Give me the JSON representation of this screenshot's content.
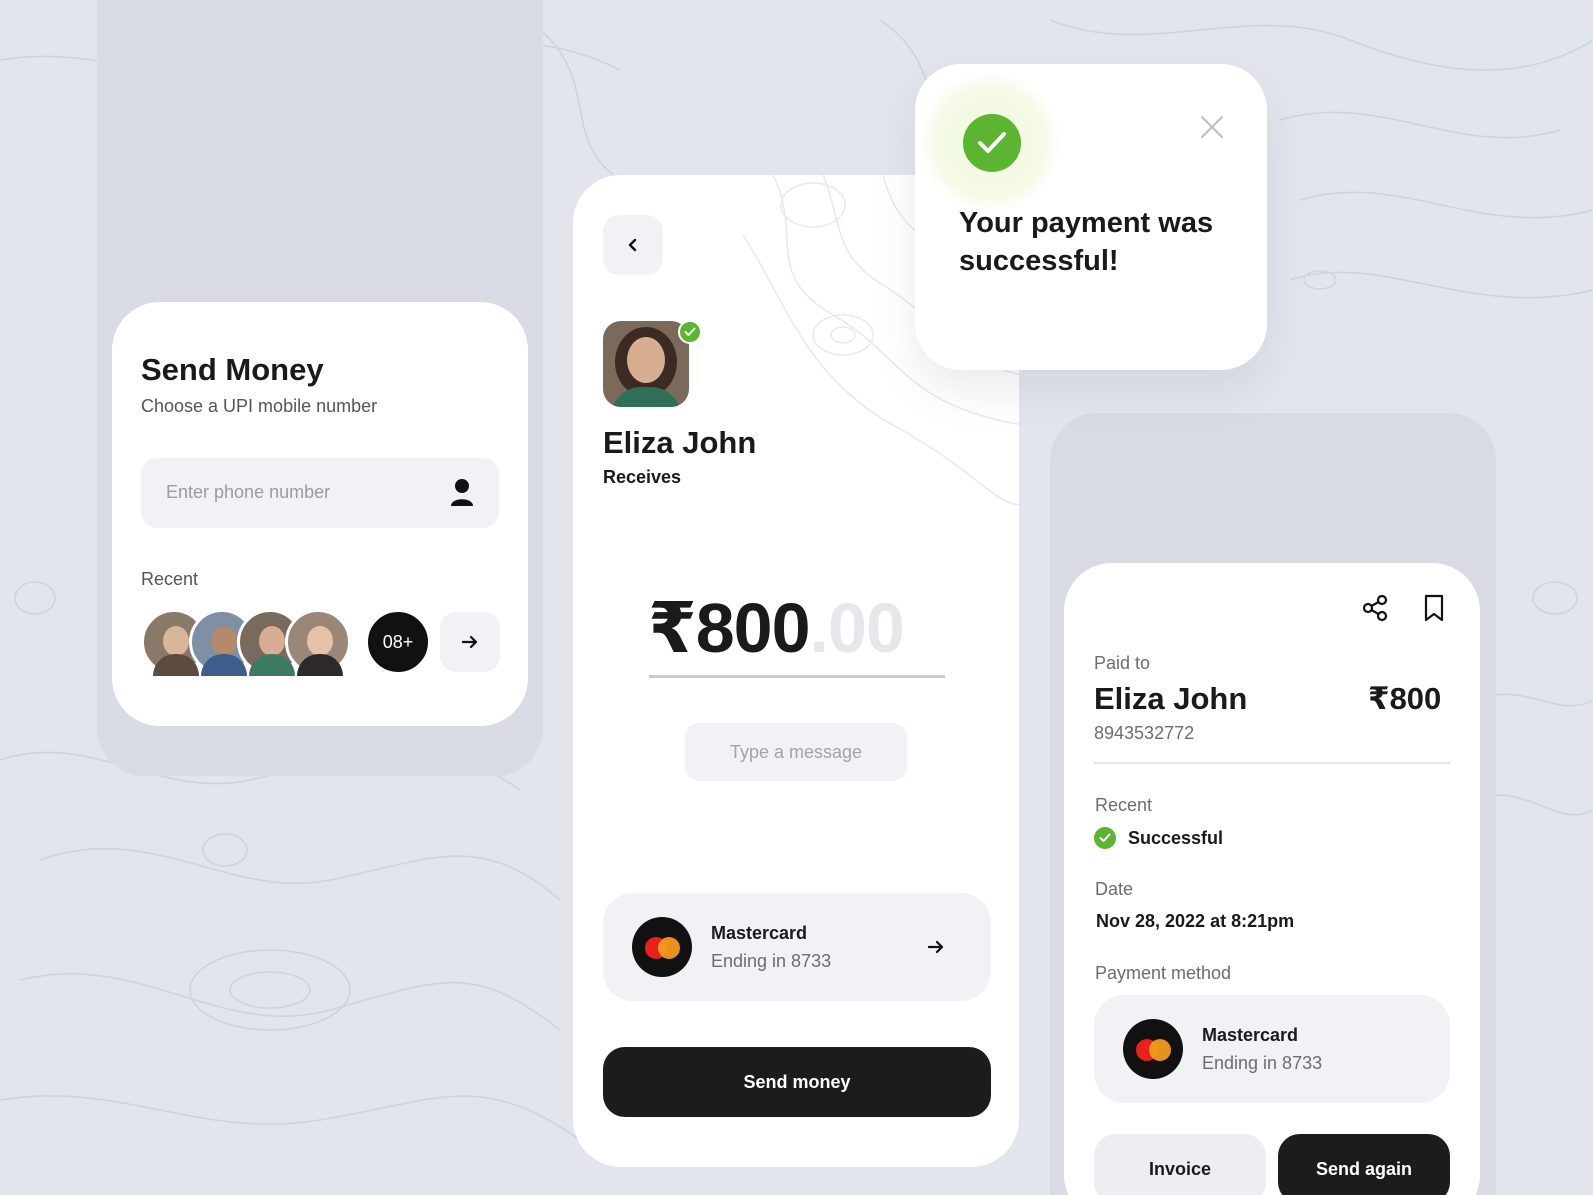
{
  "send_money": {
    "title": "Send Money",
    "subtitle": "Choose a UPI mobile number",
    "phone_placeholder": "Enter phone number",
    "recent_label": "Recent",
    "more_count": "08+"
  },
  "payment": {
    "recipient_name": "Eliza John",
    "role_label": "Receives",
    "amount_main": "₹800",
    "amount_cents": ".00",
    "message_placeholder": "Type a message",
    "card_name": "Mastercard",
    "card_ending": "Ending in 8733",
    "send_button": "Send money"
  },
  "success": {
    "message": "Your payment was successful!"
  },
  "receipt": {
    "paid_to_label": "Paid to",
    "name": "Eliza John",
    "amount": "₹800",
    "phone": "8943532772",
    "recent_label": "Recent",
    "status": "Successful",
    "date_label": "Date",
    "date_value": "Nov 28, 2022 at 8:21pm",
    "method_label": "Payment method",
    "card_name": "Mastercard",
    "card_ending": "Ending in 8733",
    "invoice_button": "Invoice",
    "again_button": "Send again"
  },
  "colors": {
    "background": "#e2e5ec",
    "success_green": "#5cb531",
    "dark_button": "#1b1d1c",
    "mastercard_red": "#e8221b",
    "mastercard_orange": "#f79e1b"
  },
  "icons": [
    "person-icon",
    "arrow-right-icon",
    "chevron-left-icon",
    "check-icon",
    "close-icon",
    "share-icon",
    "bookmark-icon",
    "mastercard-icon"
  ]
}
